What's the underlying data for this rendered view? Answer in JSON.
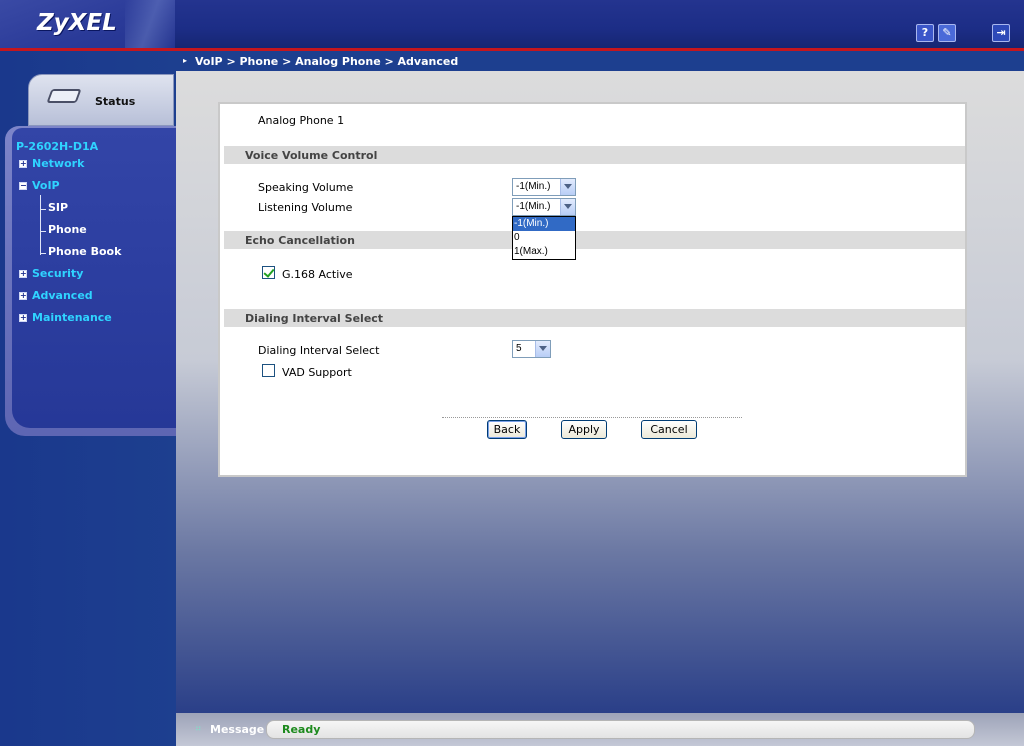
{
  "header": {
    "logo": "ZyXEL",
    "help_icon_glyph": "?",
    "wizard_icon_glyph": "✎",
    "logout_icon_glyph": "⇥"
  },
  "breadcrumb": "VoIP > Phone > Analog Phone > Advanced",
  "sidebar": {
    "status_label": "Status",
    "device_name": "P-2602H-D1A",
    "items": [
      {
        "label": "Network",
        "expanded": false
      },
      {
        "label": "VoIP",
        "expanded": true
      },
      {
        "label": "SIP",
        "sub": true
      },
      {
        "label": "Phone",
        "sub": true
      },
      {
        "label": "Phone Book",
        "sub": true
      },
      {
        "label": "Security",
        "expanded": false
      },
      {
        "label": "Advanced",
        "expanded": false
      },
      {
        "label": "Maintenance",
        "expanded": false
      }
    ]
  },
  "form": {
    "phone_name": "Analog Phone 1",
    "voice_section": "Voice Volume Control",
    "speaking_label": "Speaking Volume",
    "speaking_value": "-1(Min.)",
    "listening_label": "Listening Volume",
    "listening_value": "-1(Min.)",
    "listening_options": [
      "-1(Min.)",
      "0",
      "1(Max.)"
    ],
    "echo_section": "Echo Cancellation",
    "g168_label": "G.168 Active",
    "g168_checked": true,
    "dialing_section": "Dialing Interval Select",
    "dialing_label": "Dialing Interval Select",
    "dialing_value": "5",
    "vad_label": "VAD Support",
    "vad_checked": false
  },
  "buttons": {
    "back": "Back",
    "apply": "Apply",
    "cancel": "Cancel"
  },
  "message": {
    "label": "Message",
    "value": "Ready"
  }
}
